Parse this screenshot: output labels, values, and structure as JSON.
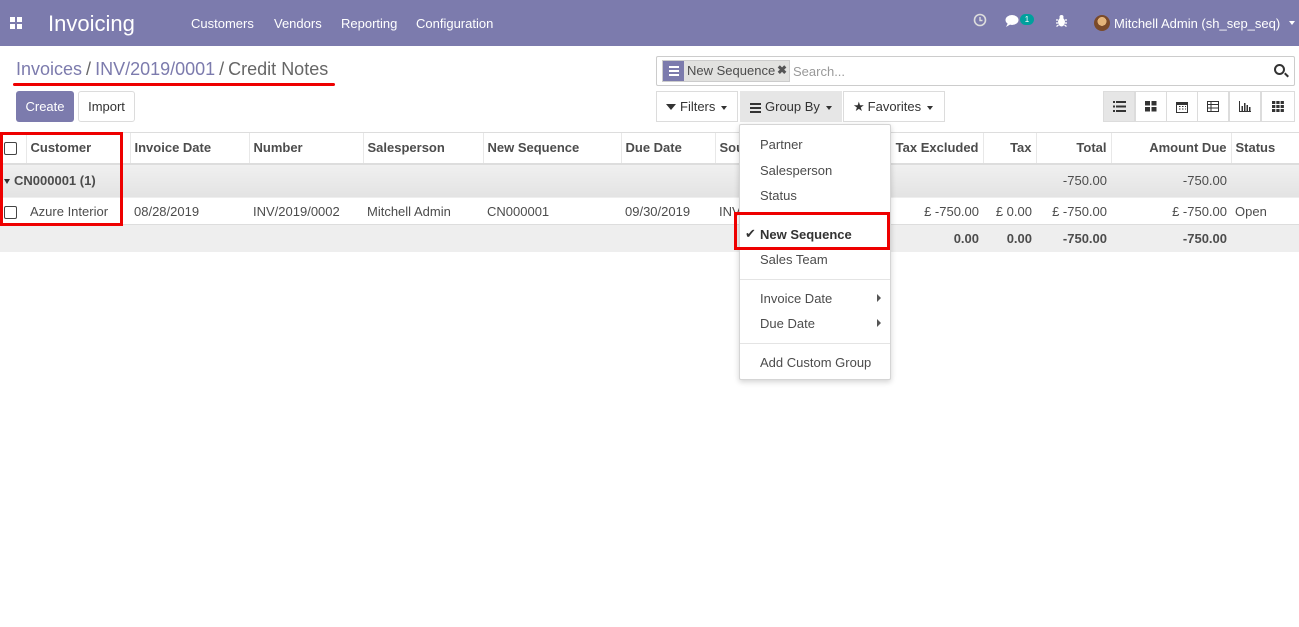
{
  "app": {
    "title": "Invoicing"
  },
  "menu": [
    "Customers",
    "Vendors",
    "Reporting",
    "Configuration"
  ],
  "systray": {
    "messages_badge": "1",
    "user": "Mitchell Admin (sh_sep_seq)"
  },
  "breadcrumb": {
    "items": [
      "Invoices",
      "INV/2019/0001"
    ],
    "current": "Credit Notes"
  },
  "buttons": {
    "create": "Create",
    "import": "Import"
  },
  "search": {
    "facet": "New Sequence",
    "placeholder": "Search..."
  },
  "controls": {
    "filters": "Filters",
    "group_by": "Group By",
    "favorites": "Favorites"
  },
  "views": [
    "list-icon",
    "kanban-icon",
    "calendar-icon",
    "pivot-icon",
    "graph-icon",
    "grid-icon"
  ],
  "table": {
    "columns": [
      "Customer",
      "Invoice Date",
      "Number",
      "Salesperson",
      "New Sequence",
      "Due Date",
      "Sou",
      "Tax Excluded",
      "Tax",
      "Total",
      "Amount Due",
      "Status"
    ],
    "group": {
      "label": "CN000001 (1)",
      "total": "-750.00",
      "amount_due": "-750.00"
    },
    "rows": [
      {
        "customer": "Azure Interior",
        "invoice_date": "08/28/2019",
        "number": "INV/2019/0002",
        "salesperson": "Mitchell Admin",
        "new_sequence": "CN000001",
        "due_date": "09/30/2019",
        "source": "INV",
        "tax_excluded": "£ -750.00",
        "tax": "£ 0.00",
        "total": "£ -750.00",
        "amount_due": "£ -750.00",
        "status": "Open"
      }
    ],
    "footer": {
      "tax_excluded": "0.00",
      "tax": "0.00",
      "total": "-750.00",
      "amount_due": "-750.00"
    }
  },
  "group_by_menu": {
    "items": [
      "Partner",
      "Salesperson",
      "Status",
      "New Sequence",
      "Sales Team"
    ],
    "selected": "New Sequence",
    "date_items": [
      "Invoice Date",
      "Due Date"
    ],
    "custom": "Add Custom Group"
  },
  "colors": {
    "brand": "#7c7bad",
    "highlight": "#ee0000",
    "badge": "#00a09d"
  }
}
